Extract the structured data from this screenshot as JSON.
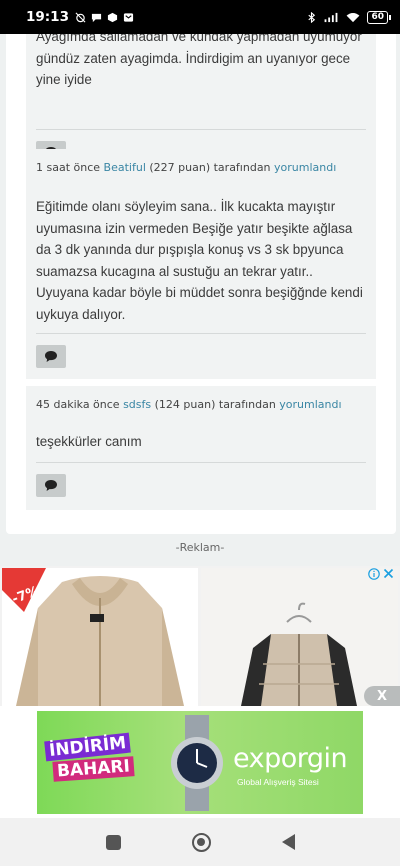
{
  "status_bar": {
    "time": "19:13",
    "battery": "60"
  },
  "comments": [
    {
      "text": "Ayağımda sallamadan ve kundak yapmadan uyumuyor gündüz zaten ayagimda. İndirdigim an uyanıyor gece yine iyide"
    },
    {
      "time": "1 saat önce",
      "user": "Beatiful",
      "points": "(227 puan) tarafından",
      "action": "yorumlandı",
      "text": "Eğitimde olanı söyleyim sana..  İlk kucakta mayıştır uyumasına izin vermeden Beşiğe yatır beşikte ağlasa da 3 dk  yanında dur pışpışla konuş vs 3 sk bpyunca suamazsa kucagına al sustuğu an tekrar yatır.. Uyuyana kadar böyle bi müddet sonra beşiğğnde kendi uykuya dalıyor."
    },
    {
      "time": "45 dakika önce",
      "user": "sdsfs",
      "points": "(124 puan) tarafından",
      "action": "yorumlandı",
      "text": "teşekkürler canım"
    }
  ],
  "ad": {
    "label": "-Reklam-",
    "discount_badge": "-7%",
    "close_label": "X",
    "info_icon": "info-icon",
    "close_icon": "close-icon"
  },
  "banner": {
    "line1": "İNDİRİM",
    "line2": "BAHARI",
    "brand": "exporgin",
    "subtitle": "Global Alışveriş Sitesi"
  },
  "colors": {
    "link": "#3a86a4",
    "comment_bg": "#f1f3f3",
    "badge": "#e53935",
    "banner_green": "#7ed957"
  }
}
